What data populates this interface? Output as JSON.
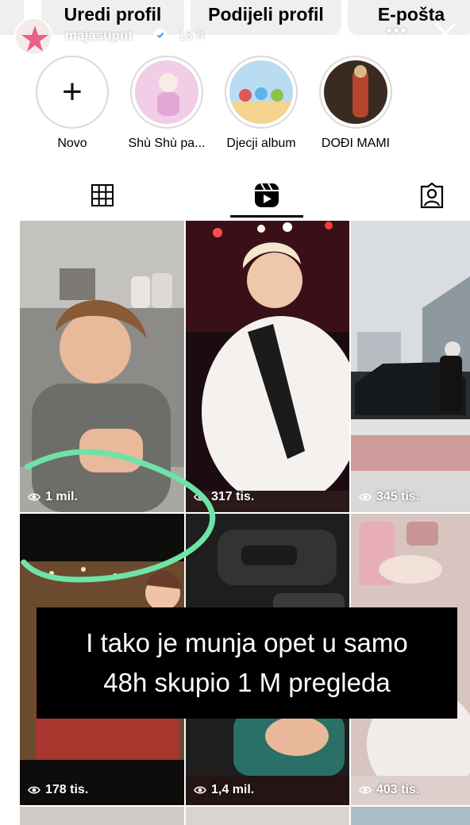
{
  "profile_buttons": {
    "edit": "Uredi profil",
    "share": "Podijeli profil",
    "email": "E-pošta"
  },
  "story": {
    "username": "majasuput",
    "time": "18 h",
    "more": "•••"
  },
  "highlights": [
    {
      "label": "Novo",
      "icon": "plus-icon"
    },
    {
      "label": "Shù Shù pa..."
    },
    {
      "label": "Djecji album"
    },
    {
      "label": "DOĐI MAMI"
    }
  ],
  "tabs": [
    {
      "icon": "grid-icon"
    },
    {
      "icon": "reels-icon",
      "active": true
    },
    {
      "icon": "tagged-icon"
    }
  ],
  "reels": [
    {
      "views": "1 mil."
    },
    {
      "views": "317 tis."
    },
    {
      "views": "345 tis."
    },
    {
      "views": "178 tis."
    },
    {
      "views": "1,4 mil."
    },
    {
      "views": "403 tis."
    }
  ],
  "caption": {
    "line1": "I tako je munja opet u samo",
    "line2": "48h skupio 1 M pregleda"
  },
  "colors": {
    "scribble": "#6ee3a7",
    "button_bg": "#efefef"
  }
}
